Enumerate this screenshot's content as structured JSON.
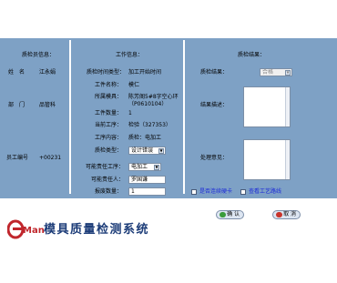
{
  "sections": {
    "inspector_info": "质检员信息：",
    "work_info": "工作信息：",
    "inspection_result": "质检结果："
  },
  "inspector": {
    "name_label": "姓　名",
    "name_value": "江永娟",
    "dept_label": "部　门",
    "dept_value": "品管科",
    "id_label": "员工编号",
    "id_value": "+00231"
  },
  "work": {
    "inspect_time_label": "质检时间类型：",
    "inspect_time_value": "加工开始时间",
    "worker_name_label": "工件名称：",
    "worker_name_value": "模仁",
    "mold_label": "所属模具：",
    "mold_value_line1": "陈芳阁5#8字空心环",
    "mold_value_line2": "（P0610104）",
    "quantity_label": "工件数量：",
    "quantity_value": "1",
    "current_process_label": "当前工序：",
    "current_process_value": "检验（327353）",
    "work_content_label": "工序内容：",
    "work_content_value": "质检：电加工",
    "inspect_type_label": "质检类型：",
    "inspect_type_value": "设计错误",
    "responsible_process_label": "可能责任工序：",
    "responsible_process_value": "电加工",
    "responsible_person_label": "可能责任人：",
    "responsible_person_value": "罗国谦",
    "scrap_qty_label": "报废数量：",
    "scrap_qty_value": "1"
  },
  "result": {
    "result_label": "质检结果：",
    "result_value": "合格",
    "description_label": "结果描述：",
    "opinion_label": "处理意见：",
    "link_card": "是否连续硬卡",
    "link_process": "查看工艺路线"
  },
  "buttons": {
    "confirm": "确 认",
    "cancel": "取 消"
  },
  "logo": {
    "brand": "Man",
    "title": "模具质量检测系统"
  }
}
